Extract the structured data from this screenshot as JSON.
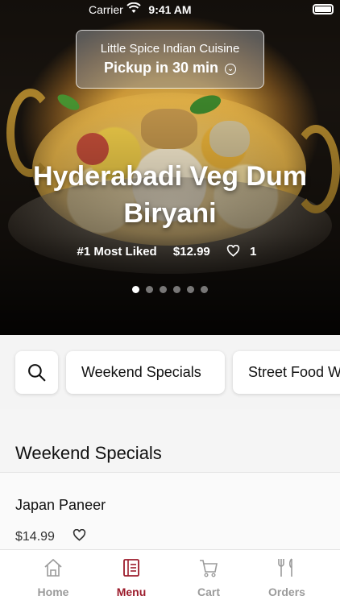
{
  "status_bar": {
    "carrier": "Carrier",
    "time": "9:41 AM"
  },
  "hero": {
    "restaurant_name": "Little Spice Indian Cuisine",
    "pickup_label": "Pickup in 30 min",
    "dish_title": "Hyderabadi Veg Dum Biryani",
    "rank_badge": "#1 Most Liked",
    "price": "$12.99",
    "likes": "1",
    "carousel": {
      "count": 6,
      "active_index": 0
    }
  },
  "categories": {
    "items": [
      "Weekend Specials",
      "Street Food W"
    ]
  },
  "section": {
    "title": "Weekend Specials",
    "items": [
      {
        "name": "Japan Paneer",
        "price": "$14.99"
      }
    ]
  },
  "tabbar": {
    "tabs": [
      {
        "label": "Home",
        "icon": "home-icon"
      },
      {
        "label": "Menu",
        "icon": "menu-icon",
        "active": true
      },
      {
        "label": "Cart",
        "icon": "cart-icon"
      },
      {
        "label": "Orders",
        "icon": "orders-icon"
      }
    ]
  },
  "colors": {
    "accent": "#9c1c2c",
    "inactive": "#9b9b9b"
  }
}
